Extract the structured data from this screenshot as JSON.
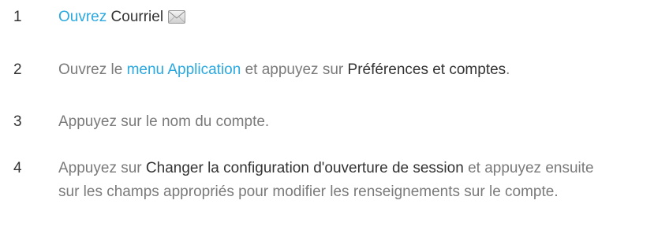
{
  "steps": [
    {
      "number": "1",
      "link": "Ouvrez",
      "app": "Courriel",
      "icon": "mail-icon"
    },
    {
      "number": "2",
      "prefix": "Ouvrez le ",
      "link": "menu Application",
      "middle": " et appuyez sur ",
      "emphasis": "Préférences et comptes",
      "suffix": "."
    },
    {
      "number": "3",
      "text": "Appuyez sur le nom du compte."
    },
    {
      "number": "4",
      "prefix": "Appuyez sur ",
      "emphasis": "Changer la configuration d'ouverture de session",
      "suffix": " et appuyez ensuite sur les champs appropriés pour modifier les renseignements sur le compte."
    }
  ],
  "colors": {
    "link": "#2aa8e0",
    "body_text": "#7a7a7a",
    "dark_text": "#333333"
  }
}
